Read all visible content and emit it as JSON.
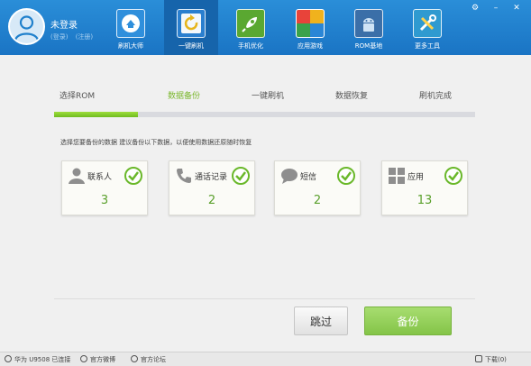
{
  "user": {
    "name": "未登录",
    "login_link": "(登录)",
    "register_link": "(注册)"
  },
  "nav": {
    "items": [
      {
        "label": "刷机大师",
        "icon": "home-cloud-icon"
      },
      {
        "label": "一键刷机",
        "icon": "refresh-icon",
        "active": true
      },
      {
        "label": "手机优化",
        "icon": "rocket-icon"
      },
      {
        "label": "应用游戏",
        "icon": "app-grid-icon"
      },
      {
        "label": "ROM基地",
        "icon": "android-icon"
      },
      {
        "label": "更多工具",
        "icon": "tools-icon"
      }
    ]
  },
  "window_controls": {
    "settings": "gear-icon",
    "minimize": "minimize-icon",
    "close": "close-icon"
  },
  "steps": {
    "items": [
      {
        "label": "选择ROM"
      },
      {
        "label": "数据备份",
        "active": true
      },
      {
        "label": "一键刷机"
      },
      {
        "label": "数据恢复"
      },
      {
        "label": "刷机完成"
      }
    ],
    "progress_fraction": 0.2
  },
  "hint": "选择您要备份的数据  建议备份以下数据，以便使用数据还原随时恢复",
  "cards": [
    {
      "label": "联系人",
      "count": "3",
      "icon": "person-icon",
      "checked": true
    },
    {
      "label": "通话记录",
      "count": "2",
      "icon": "phone-icon",
      "checked": true
    },
    {
      "label": "短信",
      "count": "2",
      "icon": "chat-bubble-icon",
      "checked": true
    },
    {
      "label": "应用",
      "count": "13",
      "icon": "app-grid-icon",
      "checked": true
    }
  ],
  "buttons": {
    "skip": "跳过",
    "backup": "备份"
  },
  "status": {
    "device": "华为 U9508 已连接",
    "weibo": "官方微博",
    "forum": "官方论坛",
    "download": "下载(0)"
  },
  "colors": {
    "header_blue": "#1f80cc",
    "accent_green": "#7cb82f",
    "check_green": "#6ab82a"
  }
}
